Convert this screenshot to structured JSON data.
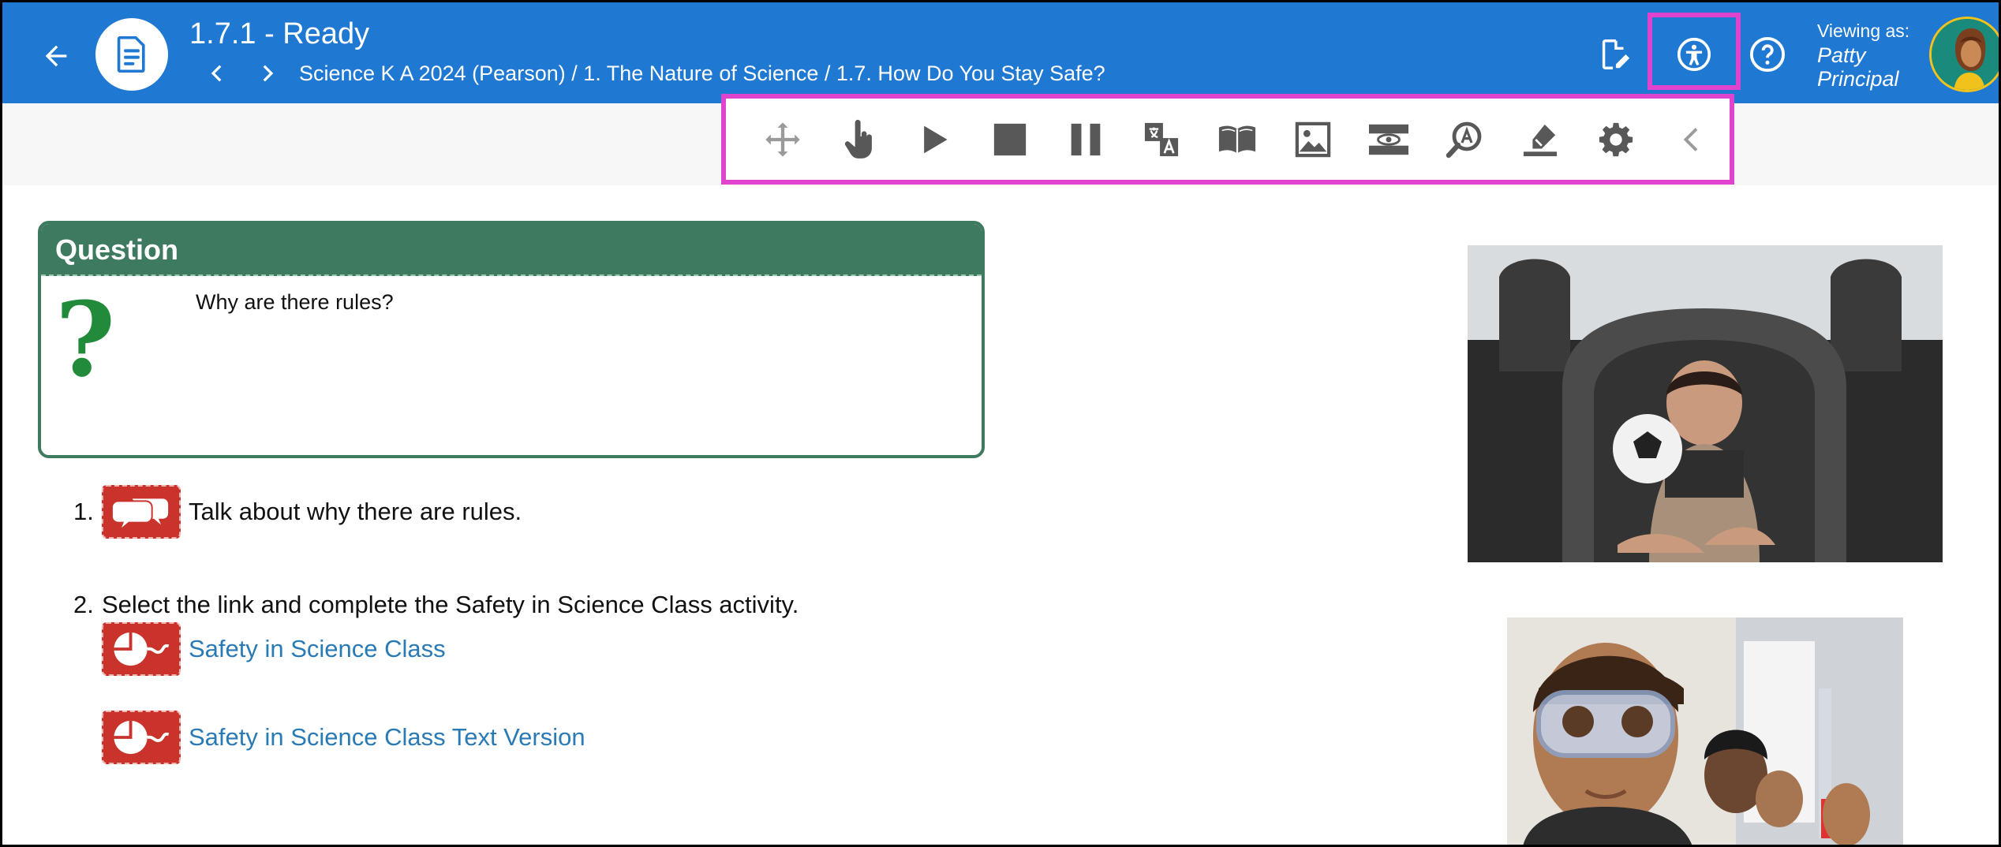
{
  "header": {
    "title": "1.7.1 - Ready",
    "breadcrumb": "Science K A 2024 (Pearson) / 1. The Nature of Science / 1.7. How Do You Stay Safe?",
    "viewing_as_label": "Viewing as:",
    "viewer_name": "Patty Principal",
    "icons": [
      "back-arrow-icon",
      "document-icon",
      "chevron-left-icon",
      "chevron-right-icon",
      "edit-document-icon",
      "accessibility-icon",
      "help-icon",
      "avatar"
    ]
  },
  "toolbar": {
    "tools": [
      "move-icon",
      "pointer-hand-icon",
      "play-icon",
      "stop-icon",
      "pause-icon",
      "translate-icon",
      "dictionary-icon",
      "picture-dictionary-icon",
      "screen-mask-icon",
      "magnifier-icon",
      "highlighter-icon",
      "settings-icon",
      "collapse-icon"
    ]
  },
  "question": {
    "heading": "Question",
    "text": "Why are there rules?"
  },
  "items": [
    {
      "number": "1.",
      "text": "Talk about why there are rules."
    },
    {
      "number": "2.",
      "text": "Select the link and complete the Safety in Science Class activity."
    }
  ],
  "links": [
    {
      "label": "Safety in Science Class"
    },
    {
      "label": "Safety in Science Class Text Version"
    }
  ],
  "colors": {
    "header_blue": "#1f78d1",
    "highlight_magenta": "#e044cf",
    "question_green": "#3d7a5f",
    "badge_red": "#c9332c",
    "link_blue": "#2a7ab5"
  }
}
